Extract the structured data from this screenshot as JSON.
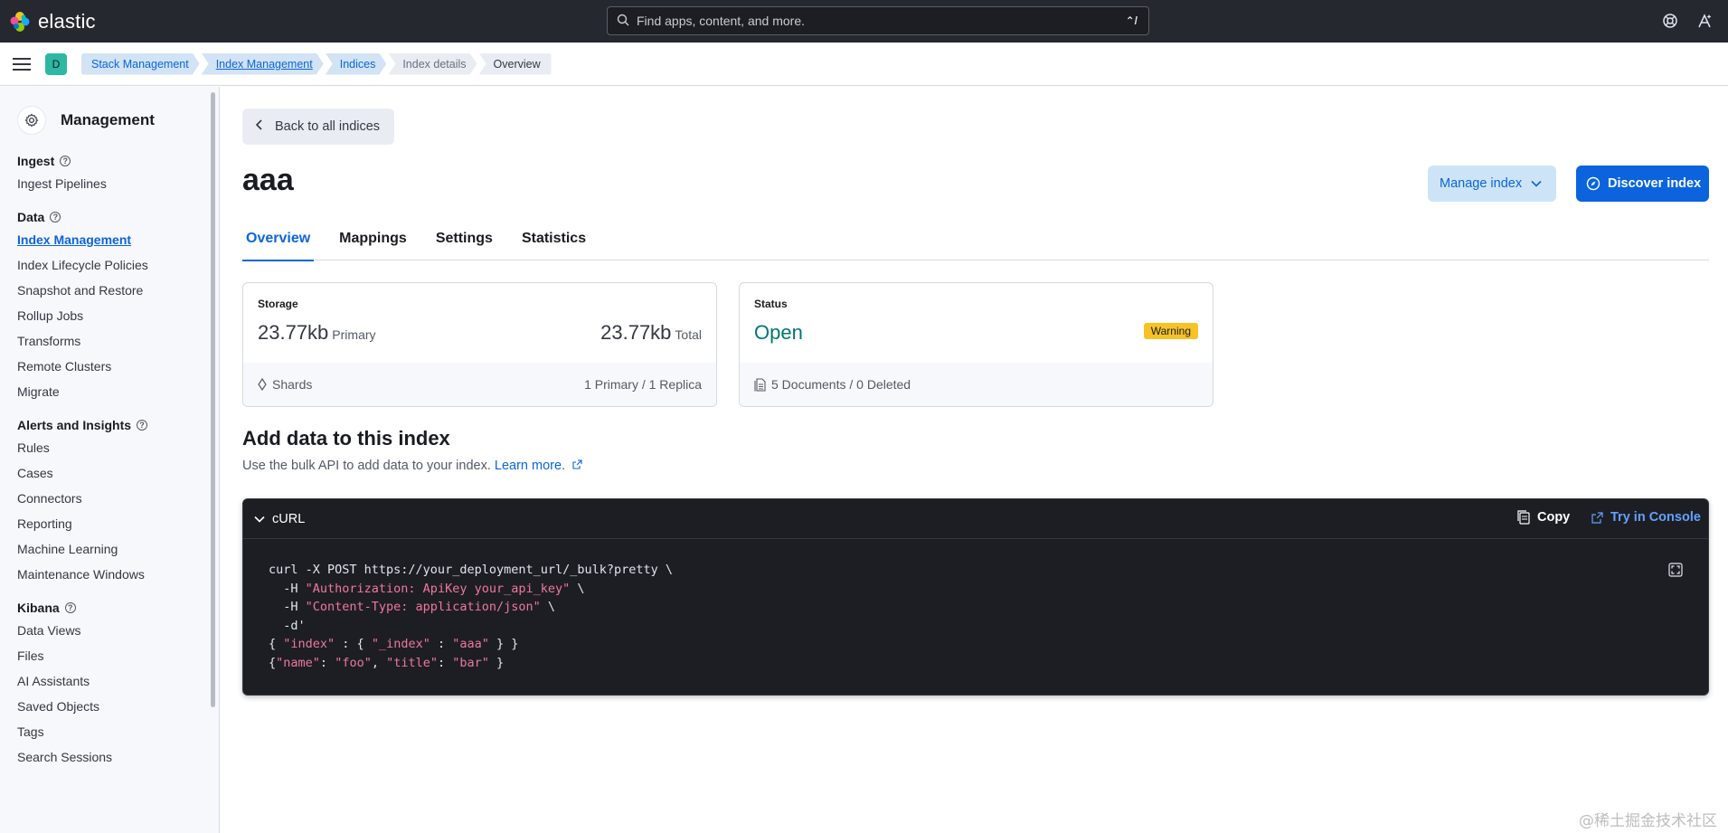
{
  "header": {
    "brand": "elastic",
    "search_placeholder": "Find apps, content, and more.",
    "search_shortcut": "⌃/"
  },
  "breadcrumbs": {
    "space_initial": "D",
    "items": [
      "Stack Management",
      "Index Management",
      "Indices",
      "Index details",
      "Overview"
    ]
  },
  "sidebar": {
    "title": "Management",
    "groups": [
      {
        "title": "Ingest",
        "items": [
          "Ingest Pipelines"
        ]
      },
      {
        "title": "Data",
        "items": [
          "Index Management",
          "Index Lifecycle Policies",
          "Snapshot and Restore",
          "Rollup Jobs",
          "Transforms",
          "Remote Clusters",
          "Migrate"
        ]
      },
      {
        "title": "Alerts and Insights",
        "items": [
          "Rules",
          "Cases",
          "Connectors",
          "Reporting",
          "Machine Learning",
          "Maintenance Windows"
        ]
      },
      {
        "title": "Kibana",
        "items": [
          "Data Views",
          "Files",
          "AI Assistants",
          "Saved Objects",
          "Tags",
          "Search Sessions"
        ]
      }
    ]
  },
  "main": {
    "back_label": "Back to all indices",
    "index_name": "aaa",
    "manage_label": "Manage index",
    "discover_label": "Discover index",
    "tabs": [
      "Overview",
      "Mappings",
      "Settings",
      "Statistics"
    ],
    "storage": {
      "label": "Storage",
      "primary_value": "23.77kb",
      "primary_label": "Primary",
      "total_value": "23.77kb",
      "total_label": "Total",
      "shards_label": "Shards",
      "shards_value": "1 Primary / 1 Replica"
    },
    "status": {
      "label": "Status",
      "value": "Open",
      "badge": "Warning",
      "docs": "5 Documents / 0 Deleted"
    },
    "add_data": {
      "title": "Add data to this index",
      "description": "Use the bulk API to add data to your index.",
      "link": "Learn more."
    },
    "code": {
      "title": "cURL",
      "copy_label": "Copy",
      "console_label": "Try in Console",
      "line1": "curl -X POST https://your_deployment_url/_bulk?pretty \\",
      "line2_prefix": "  -H ",
      "line2_str": "\"Authorization: ApiKey your_api_key\"",
      "line2_suffix": " \\",
      "line3_prefix": "  -H ",
      "line3_str": "\"Content-Type: application/json\"",
      "line3_suffix": " \\",
      "line4": "  -d'",
      "line5_a": "{ ",
      "line5_s1": "\"index\"",
      "line5_b": " : { ",
      "line5_s2": "\"_index\"",
      "line5_c": " : ",
      "line5_s3": "\"aaa\"",
      "line5_d": " } }",
      "line6_a": "{",
      "line6_s1": "\"name\"",
      "line6_b": ": ",
      "line6_s2": "\"foo\"",
      "line6_c": ", ",
      "line6_s3": "\"title\"",
      "line6_d": ": ",
      "line6_s4": "\"bar\"",
      "line6_e": " }"
    }
  },
  "watermark": "@稀土掘金技术社区",
  "colors": {
    "accent": "#0b64dd",
    "header_bg": "#25282f",
    "open_status": "#007871",
    "warning": "#f6c327",
    "code_bg": "#1d1e24"
  }
}
